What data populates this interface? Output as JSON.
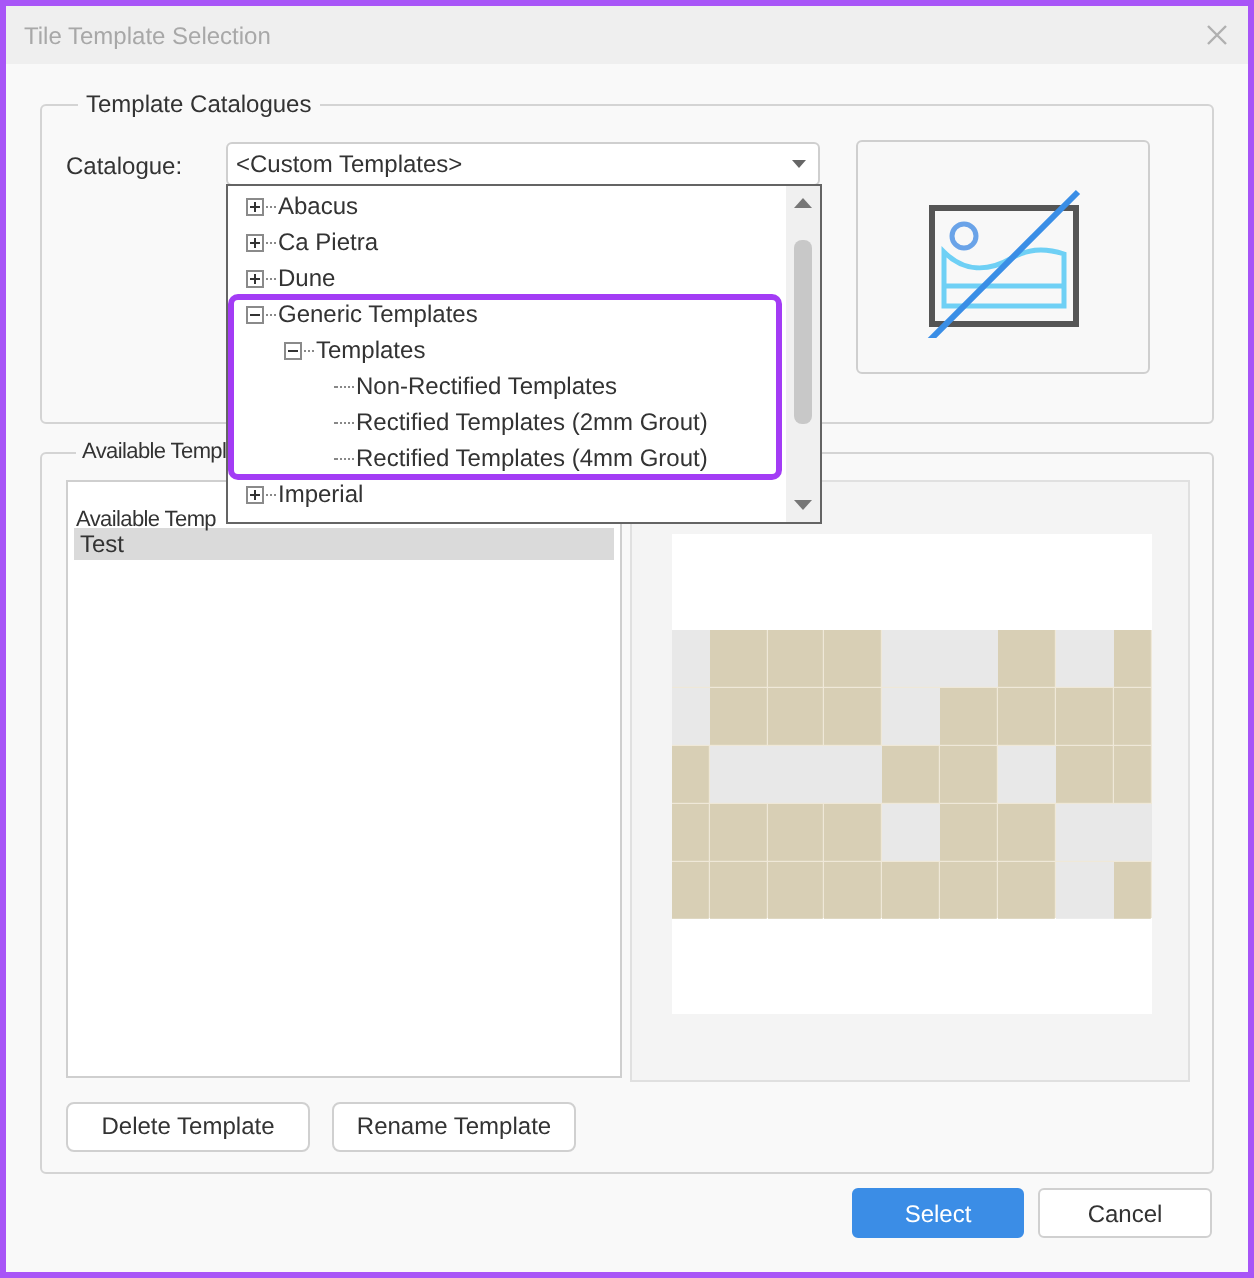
{
  "window": {
    "title": "Tile Template Selection"
  },
  "catalogue_group": {
    "title": "Template Catalogues",
    "label": "Catalogue:",
    "value": "<Custom Templates>",
    "dropdown": {
      "expanded": true,
      "items": [
        {
          "label": "Abacus",
          "expanded": false
        },
        {
          "label": "Ca Pietra",
          "expanded": false
        },
        {
          "label": "Dune",
          "expanded": false
        },
        {
          "label": "Generic Templates",
          "expanded": true,
          "highlighted": true,
          "children": [
            {
              "label": "Templates",
              "expanded": true,
              "children": [
                {
                  "label": "Non-Rectified Templates"
                },
                {
                  "label": "Rectified Templates (2mm Grout)"
                },
                {
                  "label": "Rectified Templates (4mm Grout)"
                }
              ]
            }
          ]
        },
        {
          "label": "Imperial",
          "expanded": false
        }
      ]
    }
  },
  "available_group": {
    "title": "Available Templ",
    "list": {
      "header": "Available Temp",
      "rows": [
        {
          "label": "Test",
          "selected": true
        }
      ]
    },
    "buttons": [
      "Delete Template",
      "Rename Template"
    ]
  },
  "footer_buttons": [
    {
      "label": "Select",
      "kind": "primary"
    },
    {
      "label": "Cancel",
      "kind": "secondary"
    }
  ]
}
